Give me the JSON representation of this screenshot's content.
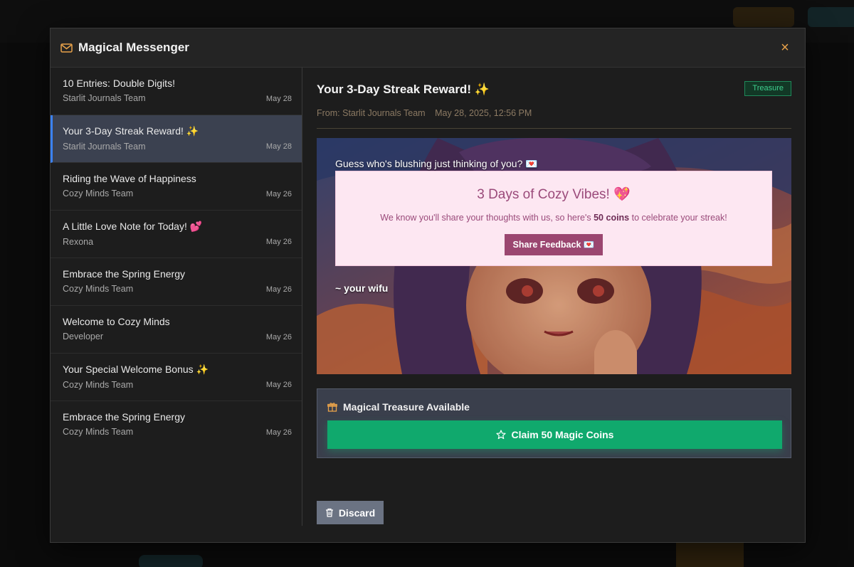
{
  "modal": {
    "title": "Magical Messenger",
    "close_label": "×"
  },
  "messages": [
    {
      "title": "10 Entries: Double Digits!",
      "sender": "Starlit Journals Team",
      "date": "May 28"
    },
    {
      "title": "Your 3-Day Streak Reward! ✨",
      "sender": "Starlit Journals Team",
      "date": "May 28"
    },
    {
      "title": "Riding the Wave of Happiness",
      "sender": "Cozy Minds Team",
      "date": "May 26"
    },
    {
      "title": "A Little Love Note for Today! 💕",
      "sender": "Rexona",
      "date": "May 26"
    },
    {
      "title": "Embrace the Spring Energy",
      "sender": "Cozy Minds Team",
      "date": "May 26"
    },
    {
      "title": "Welcome to Cozy Minds",
      "sender": "Developer",
      "date": "May 26"
    },
    {
      "title": "Your Special Welcome Bonus ✨",
      "sender": "Cozy Minds Team",
      "date": "May 26"
    },
    {
      "title": "Embrace the Spring Energy",
      "sender": "Cozy Minds Team",
      "date": "May 26"
    }
  ],
  "selected_index": 1,
  "detail": {
    "title": "Your 3-Day Streak Reward! ✨",
    "badge": "Treasure",
    "from": "From: Starlit Journals Team",
    "datetime": "May 28, 2025, 12:56 PM",
    "greeting": "Guess who's blushing just thinking of you? 💌",
    "card_title": "3 Days of Cozy Vibes! 💖",
    "card_body_prefix": "We know you'll share your thoughts with us, so here's ",
    "card_body_bold": "50 coins",
    "card_body_suffix": " to celebrate your streak!",
    "share_button": "Share Feedback 💌",
    "signoff": "~ your wifu"
  },
  "treasure": {
    "heading": "Magical Treasure Available",
    "claim_button": "Claim 50 Magic Coins"
  },
  "discard_button": "Discard",
  "icons": {
    "header": "mail-icon",
    "close": "close-icon",
    "treasure": "gift-icon",
    "claim": "star-icon",
    "discard": "trash-icon"
  },
  "colors": {
    "accent_orange": "#e8a24a",
    "selected_bg": "#3b4150",
    "selected_border": "#3b82f6",
    "badge_green": "#3fcf8e",
    "claim_green": "#10a96d",
    "card_pink": "#fde7f2",
    "card_text": "#9a4a7a",
    "share_button": "#9b4670",
    "discard_gray": "#6b7383"
  }
}
